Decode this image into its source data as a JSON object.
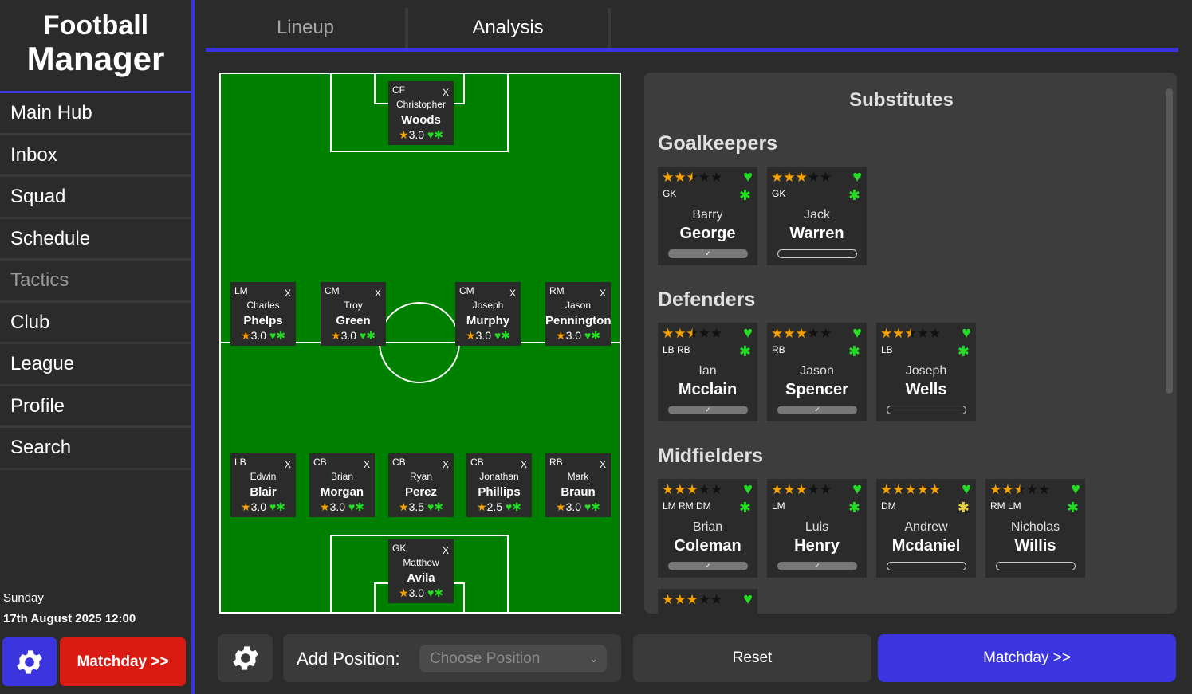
{
  "app": {
    "title_line1": "Football",
    "title_line2": "Manager"
  },
  "sidebar": {
    "items": [
      {
        "label": "Main Hub"
      },
      {
        "label": "Inbox"
      },
      {
        "label": "Squad"
      },
      {
        "label": "Schedule"
      },
      {
        "label": "Tactics"
      },
      {
        "label": "Club"
      },
      {
        "label": "League"
      },
      {
        "label": "Profile"
      },
      {
        "label": "Search"
      }
    ],
    "day": "Sunday",
    "datetime": "17th August 2025 12:00",
    "matchday_label": "Matchday >>",
    "settings_icon": "gear-icon"
  },
  "tabs": [
    {
      "label": "Lineup"
    },
    {
      "label": "Analysis"
    }
  ],
  "pitch": {
    "remove_label": "X",
    "players": [
      {
        "pos": "CF",
        "first": "Christopher",
        "last": "Woods",
        "rating": "3.0"
      },
      {
        "pos": "LM",
        "first": "Charles",
        "last": "Phelps",
        "rating": "3.0"
      },
      {
        "pos": "CM",
        "first": "Troy",
        "last": "Green",
        "rating": "3.0"
      },
      {
        "pos": "CM",
        "first": "Joseph",
        "last": "Murphy",
        "rating": "3.0"
      },
      {
        "pos": "RM",
        "first": "Jason",
        "last": "Pennington",
        "rating": "3.0"
      },
      {
        "pos": "LB",
        "first": "Edwin",
        "last": "Blair",
        "rating": "3.0"
      },
      {
        "pos": "CB",
        "first": "Brian",
        "last": "Morgan",
        "rating": "3.0"
      },
      {
        "pos": "CB",
        "first": "Ryan",
        "last": "Perez",
        "rating": "3.5"
      },
      {
        "pos": "CB",
        "first": "Jonathan",
        "last": "Phillips",
        "rating": "2.5"
      },
      {
        "pos": "RB",
        "first": "Mark",
        "last": "Braun",
        "rating": "3.0"
      },
      {
        "pos": "GK",
        "first": "Matthew",
        "last": "Avila",
        "rating": "3.0"
      }
    ]
  },
  "substitutes": {
    "title": "Substitutes",
    "groups": [
      {
        "heading": "Goalkeepers",
        "players": [
          {
            "pos": "GK",
            "first": "Barry",
            "last": "George",
            "stars": 2.5,
            "fitness": 1.0,
            "bar_mark": "✓"
          },
          {
            "pos": "GK",
            "first": "Jack",
            "last": "Warren",
            "stars": 3,
            "fitness": 0.0,
            "bar_mark": ""
          }
        ]
      },
      {
        "heading": "Defenders",
        "players": [
          {
            "pos": "LB RB",
            "first": "Ian",
            "last": "Mcclain",
            "stars": 2.5,
            "fitness": 1.0,
            "bar_mark": "✓"
          },
          {
            "pos": "RB",
            "first": "Jason",
            "last": "Spencer",
            "stars": 3,
            "fitness": 1.0,
            "bar_mark": "✓"
          },
          {
            "pos": "LB",
            "first": "Joseph",
            "last": "Wells",
            "stars": 2.5,
            "fitness": 0.0,
            "bar_mark": ""
          }
        ]
      },
      {
        "heading": "Midfielders",
        "players": [
          {
            "pos": "LM RM DM",
            "first": "Brian",
            "last": "Coleman",
            "stars": 3,
            "fitness": 1.0,
            "bar_mark": "✓"
          },
          {
            "pos": "LM",
            "first": "Luis",
            "last": "Henry",
            "stars": 3,
            "fitness": 1.0,
            "bar_mark": "✓"
          },
          {
            "pos": "DM",
            "first": "Andrew",
            "last": "Mcdaniel",
            "stars": 5,
            "fitness": 0.0,
            "bar_mark": ""
          },
          {
            "pos": "RM LM",
            "first": "Nicholas",
            "last": "Willis",
            "stars": 2.5,
            "fitness": 0.0,
            "bar_mark": ""
          }
        ]
      }
    ]
  },
  "bottom": {
    "add_position_label": "Add Position:",
    "select_placeholder": "Choose Position",
    "reset_label": "Reset",
    "matchday_label": "Matchday >>"
  },
  "colors": {
    "accent": "#3b35e0",
    "danger": "#d91a12",
    "pitch": "#008000",
    "star": "#f5a100",
    "status_green": "#22dd22"
  }
}
